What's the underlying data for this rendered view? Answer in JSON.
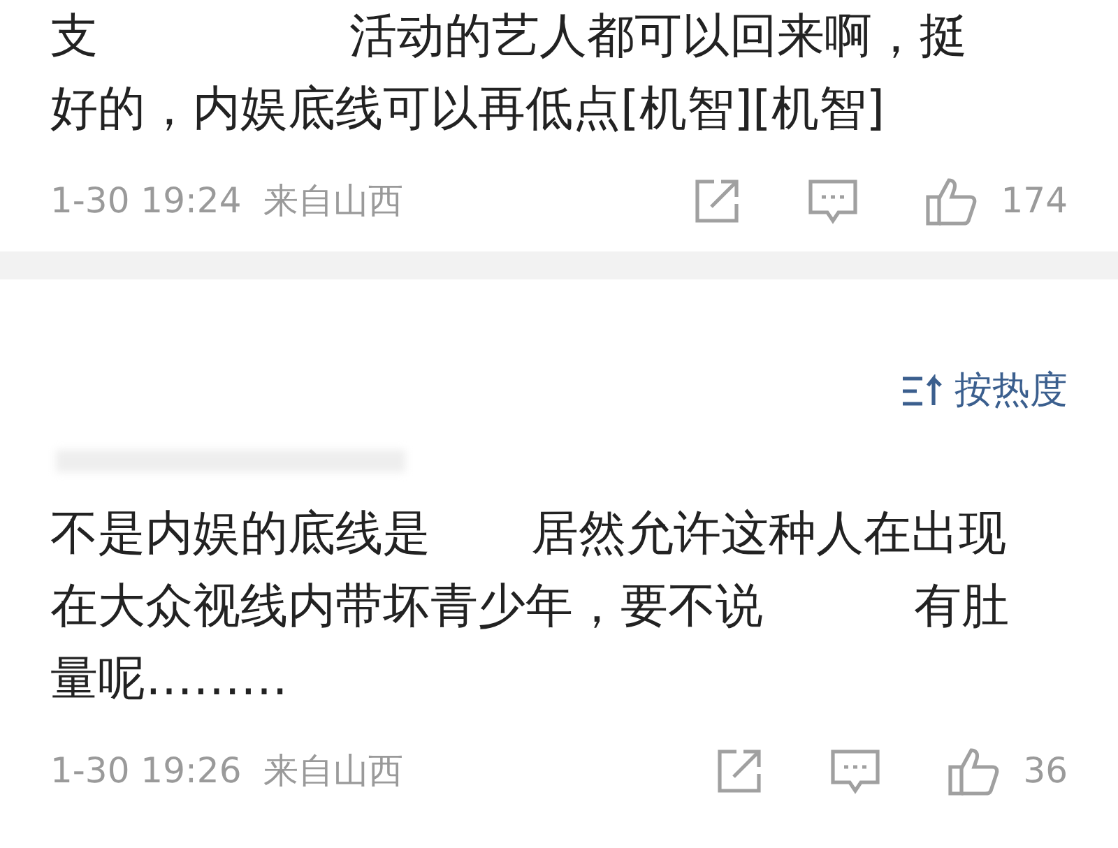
{
  "comments": [
    {
      "lines": [
        [
          {
            "kind": "text",
            "text": "支"
          },
          {
            "kind": "redacted"
          },
          {
            "kind": "redacted"
          },
          {
            "kind": "redacted"
          },
          {
            "kind": "redacted"
          },
          {
            "kind": "redacted"
          },
          {
            "kind": "text",
            "text": "活动的艺人都可以回来啊，挺"
          }
        ],
        [
          {
            "kind": "text",
            "text": "好的，内娱底线可以再低点[机智][机智]"
          }
        ]
      ],
      "time": "1-30 19:24",
      "source": "来自山西",
      "likes": "174",
      "author_hidden": false
    },
    {
      "lines": [
        [
          {
            "kind": "text",
            "text": "不是内娱的底线是"
          },
          {
            "kind": "redacted"
          },
          {
            "kind": "redacted"
          },
          {
            "kind": "text",
            "text": "居然允许这种人在出现"
          }
        ],
        [
          {
            "kind": "text",
            "text": "在大众视线内带坏青少年，要不说"
          },
          {
            "kind": "redacted"
          },
          {
            "kind": "redacted"
          },
          {
            "kind": "redacted"
          },
          {
            "kind": "text",
            "text": "有肚"
          }
        ],
        [
          {
            "kind": "text",
            "text": "量呢………"
          }
        ]
      ],
      "time": "1-30 19:26",
      "source": "来自山西",
      "likes": "36",
      "author_hidden": true
    }
  ],
  "sort": {
    "label": "按热度"
  }
}
